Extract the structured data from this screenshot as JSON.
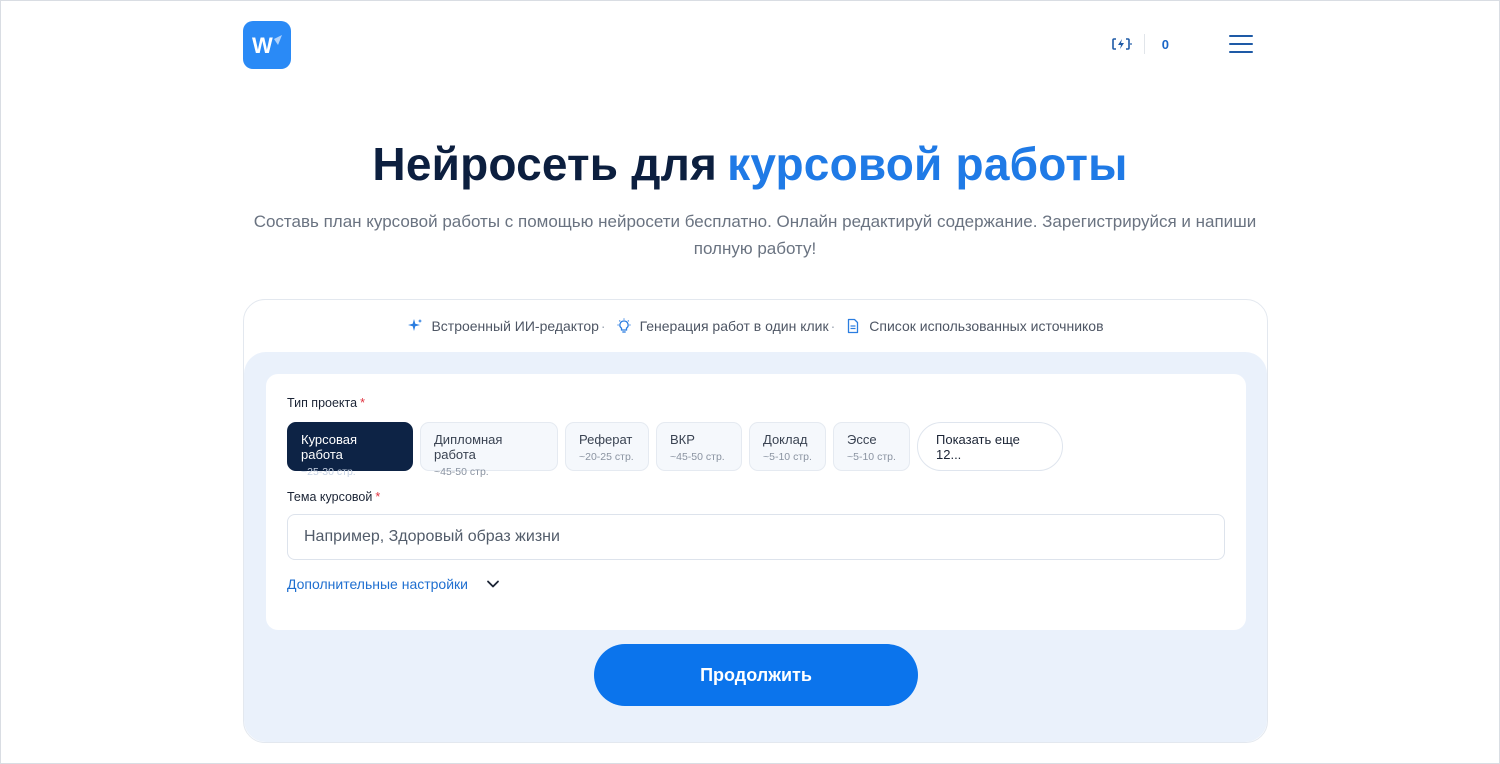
{
  "header": {
    "logo_letter": "W",
    "balance": "0"
  },
  "hero": {
    "title_main": "Нейросеть для",
    "title_accent": "курсовой работы",
    "subtitle": "Составь план курсовой работы с помощью нейросети бесплатно. Онлайн редактируй содержание. Зарегистрируйся и напиши полную работу!"
  },
  "features": [
    {
      "label": "Встроенный ИИ-редактор",
      "icon": "sparkle-icon"
    },
    {
      "label": "Генерация работ в один клик",
      "icon": "lightbulb-icon"
    },
    {
      "label": "Список использованных источников",
      "icon": "document-icon"
    }
  ],
  "form": {
    "project_type_label": "Тип проекта",
    "required_mark": "*",
    "project_types": [
      {
        "title": "Курсовая работа",
        "pages": "~25-30 стр.",
        "selected": true
      },
      {
        "title": "Дипломная работа",
        "pages": "~45-50 стр.",
        "selected": false
      },
      {
        "title": "Реферат",
        "pages": "~20-25 стр.",
        "selected": false
      },
      {
        "title": "ВКР",
        "pages": "~45-50 стр.",
        "selected": false
      },
      {
        "title": "Доклад",
        "pages": "~5-10 стр.",
        "selected": false
      },
      {
        "title": "Эссе",
        "pages": "~5-10 стр.",
        "selected": false
      }
    ],
    "show_more": "Показать еще 12...",
    "topic_label": "Тема курсовой",
    "topic_placeholder": "Например, Здоровый образ жизни",
    "topic_value": "",
    "advanced_settings": "Дополнительные настройки",
    "continue": "Продолжить"
  },
  "colors": {
    "accent": "#1f7ae6",
    "button": "#0b74ec",
    "selected_chip": "#0d2345",
    "panel_bg": "#eaf1fb"
  }
}
